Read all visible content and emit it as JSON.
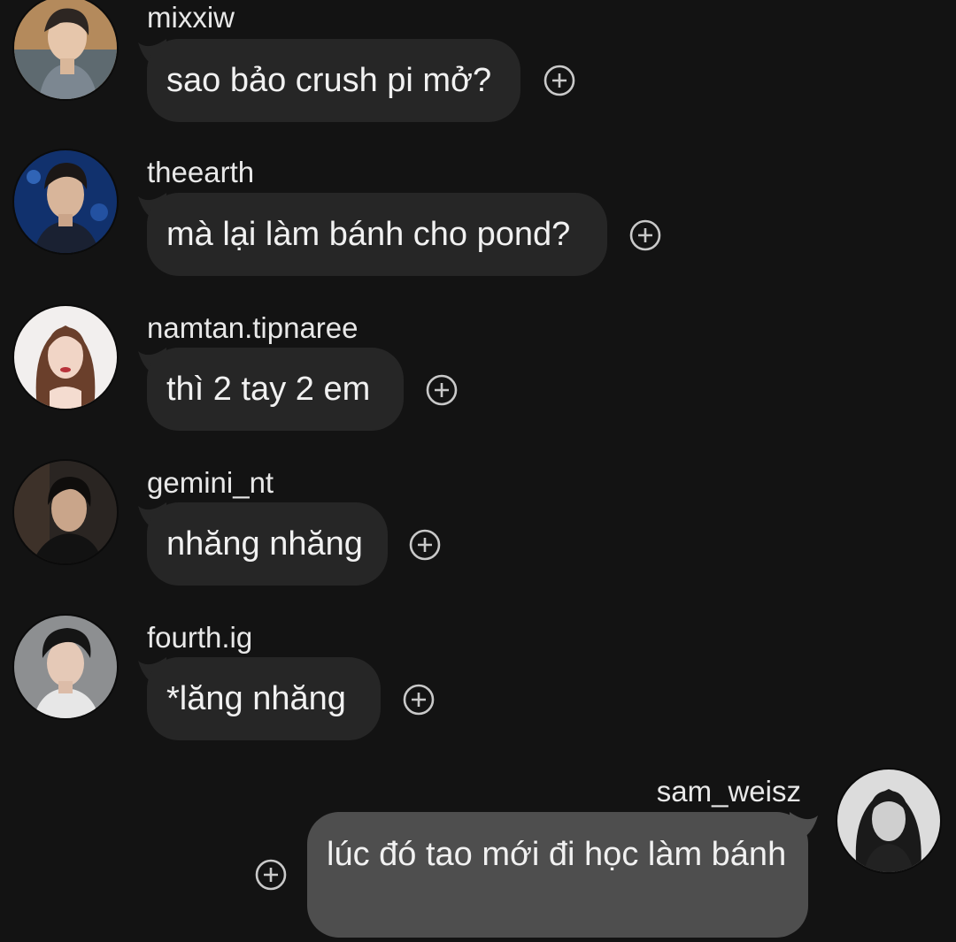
{
  "messages": [
    {
      "username": "mixxiw",
      "text": "sao bảo crush pi mở?",
      "avatar": "mixxiw-avatar",
      "action_icon": "add-reaction-icon"
    },
    {
      "username": "theearth",
      "text": "mà lại làm bánh cho pond?",
      "avatar": "theearth-avatar",
      "action_icon": "add-reaction-icon"
    },
    {
      "username": "namtan.tipnaree",
      "text": "thì 2 tay 2 em",
      "avatar": "namtan-avatar",
      "action_icon": "add-reaction-icon"
    },
    {
      "username": "gemini_nt",
      "text": "nhăng nhăng",
      "avatar": "gemini-avatar",
      "action_icon": "add-reaction-icon"
    },
    {
      "username": "fourth.ig",
      "text": "*lăng nhăng",
      "avatar": "fourth-avatar",
      "action_icon": "add-reaction-icon"
    },
    {
      "username": "sam_weisz",
      "text": "lúc đó tao mới đi học làm bánh",
      "avatar": "sam-avatar",
      "action_icon": "add-reaction-icon"
    }
  ],
  "colors": {
    "background": "#131313",
    "incoming_bubble": "#262626",
    "outgoing_bubble": "#4e4e4e",
    "text": "#f1f1f1"
  }
}
